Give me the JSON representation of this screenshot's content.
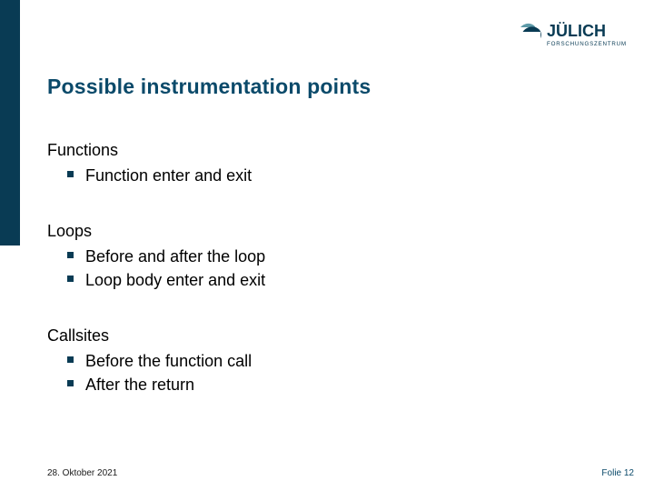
{
  "brand": {
    "name": "JÜLICH",
    "sub": "FORSCHUNGSZENTRUM"
  },
  "title": "Possible instrumentation points",
  "sections": [
    {
      "heading": "Functions",
      "items": [
        "Function enter and exit"
      ]
    },
    {
      "heading": "Loops",
      "items": [
        "Before and after the loop",
        "Loop body enter and exit"
      ]
    },
    {
      "heading": "Callsites",
      "items": [
        "Before the function call",
        "After the return"
      ]
    }
  ],
  "footer": {
    "date": "28. Oktober 2021",
    "page_label": "Folie 12"
  },
  "colors": {
    "accent": "#093b54",
    "title": "#0b4a6a"
  }
}
